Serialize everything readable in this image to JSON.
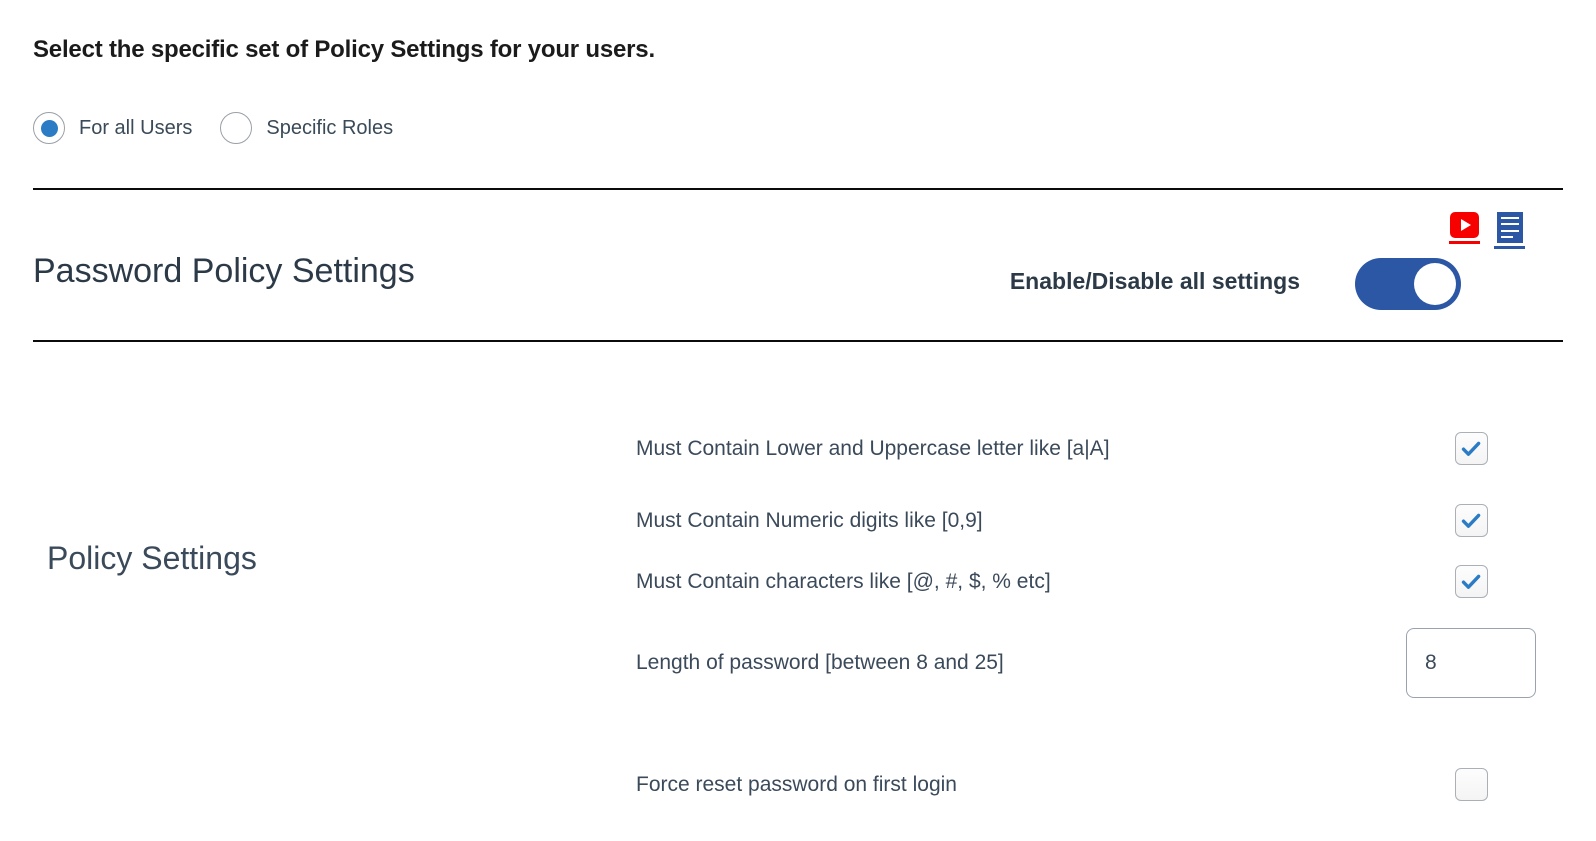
{
  "intro": {
    "heading": "Select the specific set of Policy Settings for your users.",
    "scope_options": [
      {
        "label": "For all Users",
        "selected": true
      },
      {
        "label": "Specific Roles",
        "selected": false
      }
    ]
  },
  "section": {
    "title": "Password Policy Settings",
    "toggle_label": "Enable/Disable all settings",
    "toggle_state": "on",
    "help_icons": [
      {
        "name": "video-tutorial-icon",
        "color": "#f60000"
      },
      {
        "name": "documentation-icon",
        "color": "#2b57a4"
      }
    ]
  },
  "policy": {
    "group_label": "Policy Settings",
    "rows": [
      {
        "label": "Must Contain Lower and Uppercase letter like [a|A]",
        "control": "checkbox",
        "checked": true
      },
      {
        "label": "Must Contain Numeric digits like [0,9]",
        "control": "checkbox",
        "checked": true
      },
      {
        "label": "Must Contain characters like [@, #, $, % etc]",
        "control": "checkbox",
        "checked": true
      },
      {
        "label": "Length of password [between 8 and 25]",
        "control": "number",
        "value": "8"
      },
      {
        "label": "Force reset password on first login",
        "control": "checkbox",
        "checked": false
      }
    ]
  },
  "colors": {
    "accent_blue": "#2b57a4",
    "check_blue": "#2b7cc4",
    "radio_blue": "#2b7cc4",
    "video_red": "#f60000",
    "text": "#3b4a5a",
    "rule": "#0b0b0b"
  }
}
